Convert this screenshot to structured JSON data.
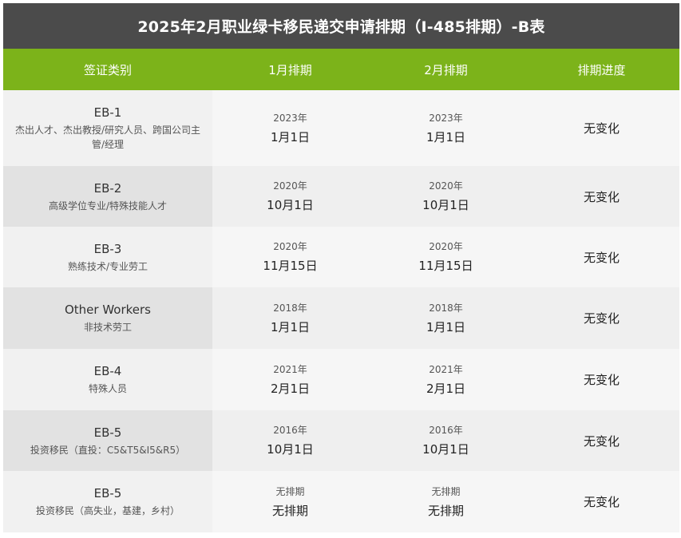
{
  "title": "2025年2月职业绿卡移民递交申请排期（I-485排期）-B表",
  "headers": [
    "签证类别",
    "1月排期",
    "2月排期",
    "排期进度"
  ],
  "rows": [
    {
      "category": "EB-1",
      "desc": "杰出人才、杰出教授/研究人员、跨国公司主管/经理",
      "jan_year": "2023年",
      "jan_date": "1月1日",
      "feb_year": "2023年",
      "feb_date": "1月1日",
      "progress": "无变化"
    },
    {
      "category": "EB-2",
      "desc": "高级学位专业/特殊技能人才",
      "jan_year": "2020年",
      "jan_date": "10月1日",
      "feb_year": "2020年",
      "feb_date": "10月1日",
      "progress": "无变化"
    },
    {
      "category": "EB-3",
      "desc": "熟练技术/专业劳工",
      "jan_year": "2020年",
      "jan_date": "11月15日",
      "feb_year": "2020年",
      "feb_date": "11月15日",
      "progress": "无变化"
    },
    {
      "category": "Other Workers",
      "desc": "非技术劳工",
      "jan_year": "2018年",
      "jan_date": "1月1日",
      "feb_year": "2018年",
      "feb_date": "1月1日",
      "progress": "无变化"
    },
    {
      "category": "EB-4",
      "desc": "特殊人员",
      "jan_year": "2021年",
      "jan_date": "2月1日",
      "feb_year": "2021年",
      "feb_date": "2月1日",
      "progress": "无变化"
    },
    {
      "category": "EB-5",
      "desc": "投资移民（直投：C5&T5&I5&R5）",
      "jan_year": "2016年",
      "jan_date": "10月1日",
      "feb_year": "2016年",
      "feb_date": "10月1日",
      "progress": "无变化"
    },
    {
      "category": "EB-5",
      "desc": "投资移民（高失业，基建，乡村）",
      "jan_year": "无排期",
      "jan_date": "无排期",
      "feb_year": "无排期",
      "feb_date": "无排期",
      "progress": "无变化"
    }
  ]
}
